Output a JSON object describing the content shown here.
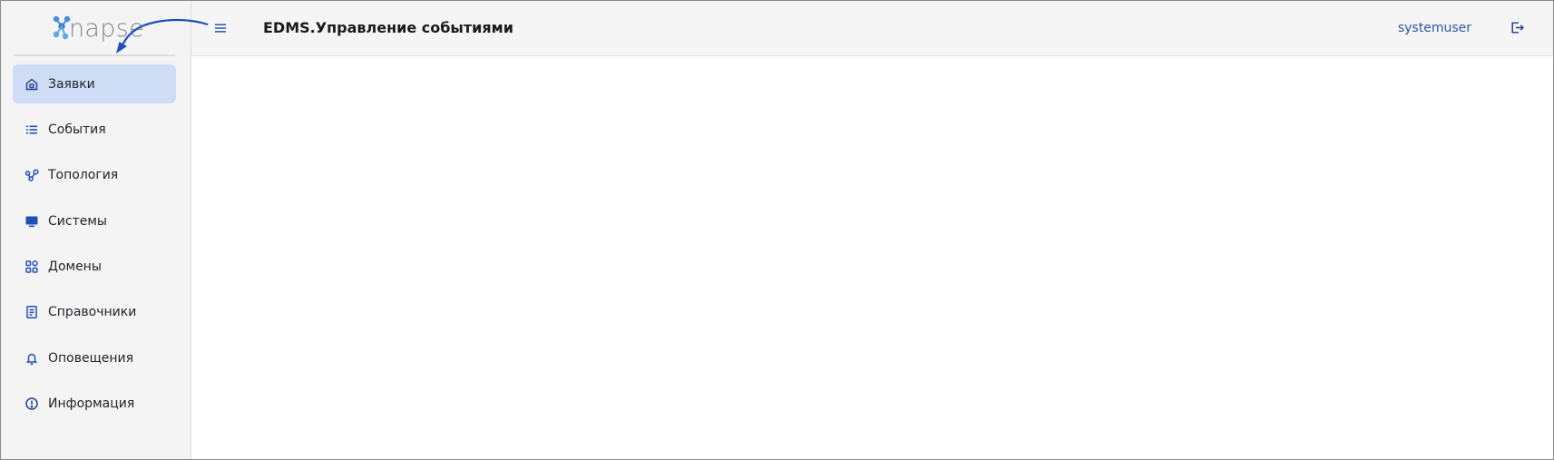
{
  "app": {
    "logo_text": "napse",
    "title": "EDMS.Управление событиями",
    "user": "systemuser"
  },
  "sidebar": {
    "items": [
      {
        "label": "Заявки",
        "icon": "home-icon",
        "active": true
      },
      {
        "label": "События",
        "icon": "list-icon",
        "active": false
      },
      {
        "label": "Топология",
        "icon": "topology-icon",
        "active": false
      },
      {
        "label": "Системы",
        "icon": "monitor-icon",
        "active": false
      },
      {
        "label": "Домены",
        "icon": "grid-icon",
        "active": false
      },
      {
        "label": "Справочники",
        "icon": "document-icon",
        "active": false
      },
      {
        "label": "Оповещения",
        "icon": "bell-icon",
        "active": false
      },
      {
        "label": "Информация",
        "icon": "info-icon",
        "active": false
      }
    ]
  },
  "colors": {
    "accent": "#1f4fb8",
    "active_bg": "#cfdcf5",
    "annotation": "#1f4fb8"
  }
}
